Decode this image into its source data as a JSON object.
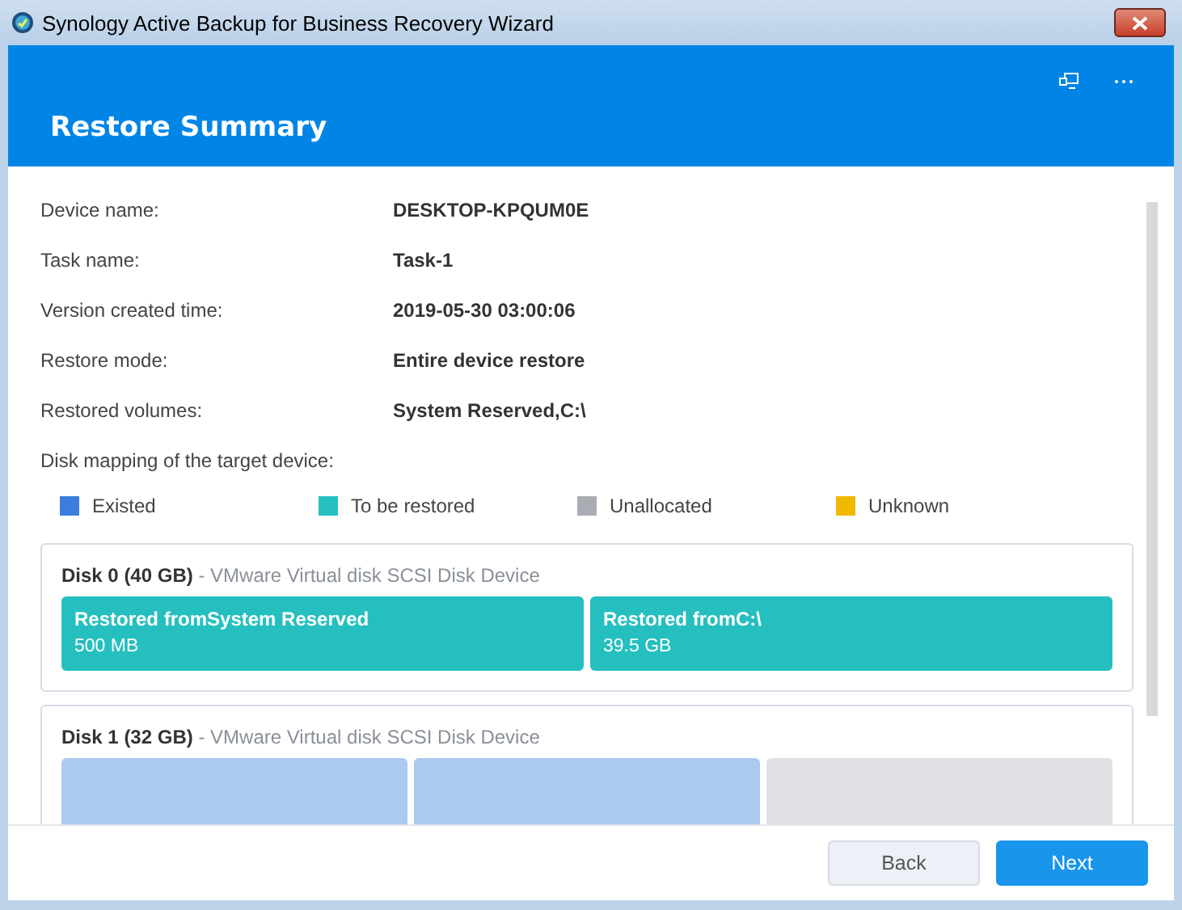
{
  "window": {
    "title": "Synology Active Backup for Business Recovery Wizard"
  },
  "header": {
    "title": "Restore Summary"
  },
  "summary": [
    {
      "label": "Device name:",
      "value": "DESKTOP-KPQUM0E"
    },
    {
      "label": "Task name:",
      "value": "Task-1"
    },
    {
      "label": "Version created time:",
      "value": "2019-05-30 03:00:06"
    },
    {
      "label": "Restore mode:",
      "value": "Entire device restore"
    },
    {
      "label": "Restored volumes:",
      "value": "System Reserved,C:\\"
    }
  ],
  "mapping_label": "Disk mapping of the target device:",
  "legend": [
    {
      "label": "Existed",
      "color": "#3b7ddd"
    },
    {
      "label": "To be restored",
      "color": "#26bfbf"
    },
    {
      "label": "Unallocated",
      "color": "#a9adb3"
    },
    {
      "label": "Unknown",
      "color": "#f0b800"
    }
  ],
  "disks": [
    {
      "name": "Disk 0 (40 GB)",
      "model": "- VMware Virtual disk SCSI Disk Device",
      "partitions": [
        {
          "kind": "restored",
          "title": "Restored fromSystem Reserved",
          "size": "500 MB"
        },
        {
          "kind": "restored",
          "title": "Restored fromC:\\",
          "size": "39.5 GB"
        }
      ]
    },
    {
      "name": "Disk 1 (32 GB)",
      "model": "- VMware Virtual disk SCSI Disk Device",
      "partitions": [
        {
          "kind": "existed"
        },
        {
          "kind": "existed"
        },
        {
          "kind": "unallocated"
        }
      ]
    }
  ],
  "buttons": [
    {
      "label": "Back",
      "kind": "secondary"
    },
    {
      "label": "Next",
      "kind": "primary"
    }
  ]
}
